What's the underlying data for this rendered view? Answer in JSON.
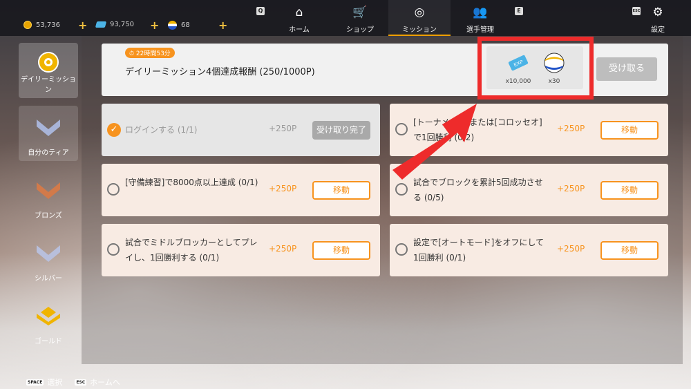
{
  "currencies": [
    {
      "icon": "gold-coin-icon",
      "value": "53,736"
    },
    {
      "icon": "exp-ticket-icon",
      "value": "93,750"
    },
    {
      "icon": "volleyball-icon",
      "value": "68"
    }
  ],
  "plus_label": "+",
  "nav": {
    "key_left": "Q",
    "key_right": "E",
    "items": [
      {
        "label": "ホーム",
        "icon": "home-icon"
      },
      {
        "label": "ショップ",
        "icon": "cart-icon"
      },
      {
        "label": "ミッション",
        "icon": "mission-icon"
      },
      {
        "label": "選手管理",
        "icon": "players-icon"
      }
    ],
    "settings_label": "設定",
    "settings_key": "ESC"
  },
  "sidebar": {
    "items": [
      {
        "label": "デイリーミッション"
      },
      {
        "label": "自分のティア"
      },
      {
        "label": "ブロンズ"
      },
      {
        "label": "シルバー"
      },
      {
        "label": "ゴールド"
      }
    ]
  },
  "banner": {
    "timer": "22時間53分",
    "title": "デイリーミッション4個達成報酬 (250/1000P)",
    "rewards": [
      {
        "icon": "exp-ticket-icon",
        "amount": "x10,000"
      },
      {
        "icon": "volleyball-icon",
        "amount": "x30"
      }
    ],
    "claim_label": "受け取る"
  },
  "missions": [
    {
      "text": "ログインする (1/1)",
      "points": "+250P",
      "button": "受け取り完了",
      "done": true
    },
    {
      "text": "[トーナメント]または[コロッセオ]で1回勝利 (0/2)",
      "points": "+250P",
      "button": "移動",
      "done": false
    },
    {
      "text": "[守備練習]で8000点以上達成 (0/1)",
      "points": "+250P",
      "button": "移動",
      "done": false
    },
    {
      "text": "試合でブロックを累計5回成功させる (0/5)",
      "points": "+250P",
      "button": "移動",
      "done": false
    },
    {
      "text": "試合でミドルブロッカーとしてプレイし、1回勝利する (0/1)",
      "points": "+250P",
      "button": "移動",
      "done": false
    },
    {
      "text": "設定で[オートモード]をオフにして1回勝利 (0/1)",
      "points": "+250P",
      "button": "移動",
      "done": false
    }
  ],
  "footer": {
    "select_key": "SPACE",
    "select_label": "選択",
    "home_key": "ESC",
    "home_label": "ホームへ"
  },
  "colors": {
    "accent": "#f7931e",
    "highlight": "#ee2b2b"
  }
}
